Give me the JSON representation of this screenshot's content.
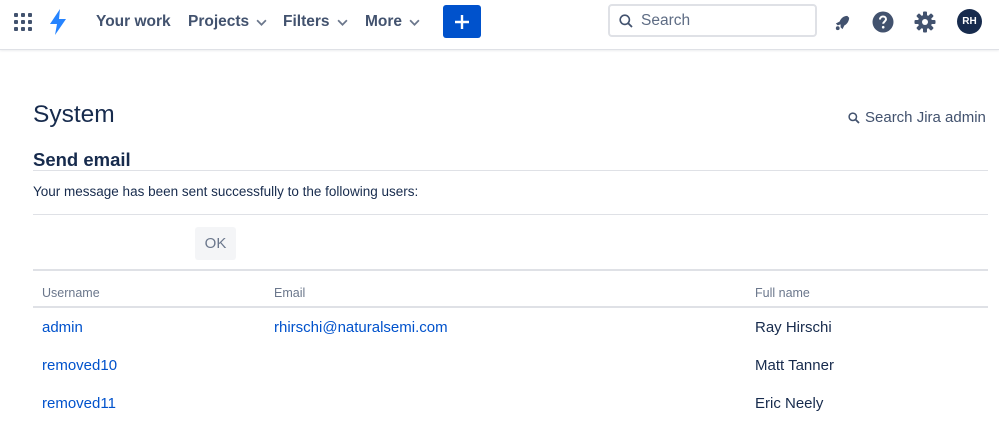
{
  "nav": {
    "your_work": "Your work",
    "projects": "Projects",
    "filters": "Filters",
    "more": "More",
    "search_placeholder": "Search",
    "avatar_initials": "RH",
    "accent_color": "#0052cc"
  },
  "page": {
    "title": "System",
    "admin_search": "Search Jira admin",
    "section_title": "Send email",
    "message": "Your message has been sent successfully to the following users:",
    "ok_label": "OK"
  },
  "table": {
    "headers": {
      "username": "Username",
      "email": "Email",
      "full_name": "Full name"
    },
    "rows": [
      {
        "username": "admin",
        "email": "rhirschi@naturalsemi.com",
        "full_name": "Ray Hirschi"
      },
      {
        "username": "removed10",
        "email": "",
        "full_name": "Matt Tanner"
      },
      {
        "username": "removed11",
        "email": "",
        "full_name": "Eric Neely"
      }
    ]
  }
}
